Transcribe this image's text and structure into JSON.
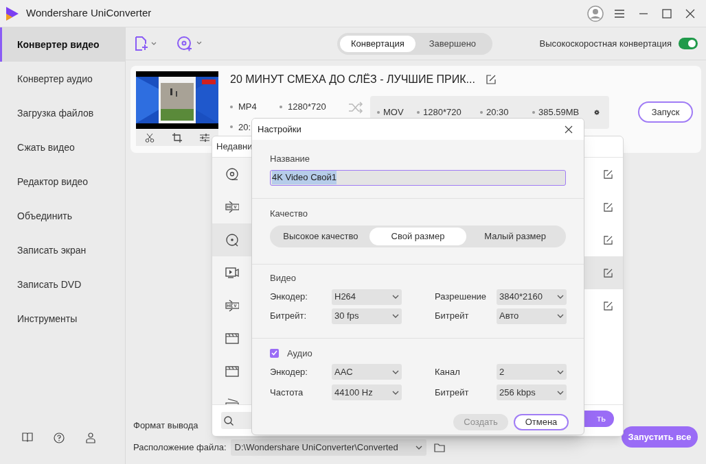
{
  "window": {
    "title": "Wondershare UniConverter"
  },
  "sidebar": {
    "items": [
      {
        "label": "Конвертер видео",
        "selected": true
      },
      {
        "label": "Конвертер аудио",
        "selected": false
      },
      {
        "label": "Загрузка файлов",
        "selected": false
      },
      {
        "label": "Сжать видео",
        "selected": false
      },
      {
        "label": "Редактор видео",
        "selected": false
      },
      {
        "label": "Объединить",
        "selected": false
      },
      {
        "label": "Записать экран",
        "selected": false
      },
      {
        "label": "Записать DVD",
        "selected": false
      },
      {
        "label": "Инструменты",
        "selected": false
      }
    ]
  },
  "toolbar": {
    "tabs": [
      {
        "label": "Конвертация",
        "selected": true
      },
      {
        "label": "Завершено",
        "selected": false
      }
    ],
    "fast_conversion": {
      "label": "Высокоскоростная конвертация",
      "on": true
    }
  },
  "file": {
    "title": "20 МИНУТ СМЕХА ДО СЛЁЗ - ЛУЧШИЕ ПРИК...",
    "source": [
      "MP4",
      "1280*720",
      "20:"
    ],
    "target": [
      "MOV",
      "1280*720",
      "20:30",
      "385.59MB"
    ],
    "start_button": "Запуск"
  },
  "bottom": {
    "output_format_label": "Формат вывода",
    "location_label": "Расположение файла:",
    "location_path": "D:\\Wondershare UniConverter\\Converted",
    "start_all": "Запустить все"
  },
  "format_popup": {
    "header": "Недавни",
    "button": "ть",
    "rows": [
      {
        "kind": "disc",
        "selected": false,
        "hovered": false,
        "editable": true
      },
      {
        "kind": "hevc",
        "selected": false,
        "hovered": false,
        "editable": true
      },
      {
        "kind": "disc-dot",
        "selected": true,
        "hovered": false,
        "editable": true
      },
      {
        "kind": "video",
        "selected": false,
        "hovered": true,
        "editable": true
      },
      {
        "kind": "hevc",
        "selected": false,
        "hovered": false,
        "editable": true
      },
      {
        "kind": "clapper",
        "selected": false,
        "hovered": false,
        "editable": false
      },
      {
        "kind": "clapper",
        "selected": false,
        "hovered": false,
        "editable": false
      },
      {
        "kind": "m4v",
        "selected": false,
        "hovered": false,
        "editable": false
      }
    ]
  },
  "dialog": {
    "title": "Настройки",
    "name": {
      "label": "Название",
      "value": "4K Video Свой1"
    },
    "quality": {
      "label": "Качество",
      "options": [
        {
          "label": "Высокое качество",
          "selected": false
        },
        {
          "label": "Свой размер",
          "selected": true
        },
        {
          "label": "Малый размер",
          "selected": false
        }
      ]
    },
    "video": {
      "label": "Видео",
      "fields": [
        {
          "label": "Энкодер:",
          "value": "H264"
        },
        {
          "label": "Разрешение",
          "value": "3840*2160"
        },
        {
          "label": "Битрейт:",
          "value": "30 fps"
        },
        {
          "label": "Битрейт",
          "value": "Авто"
        }
      ]
    },
    "audio": {
      "label": "Аудио",
      "checked": true,
      "fields": [
        {
          "label": "Энкодер:",
          "value": "AAC"
        },
        {
          "label": "Канал",
          "value": "2"
        },
        {
          "label": "Частота",
          "value": "44100 Hz"
        },
        {
          "label": "Битрейт",
          "value": "256 kbps"
        }
      ]
    },
    "buttons": [
      {
        "label": "Создать",
        "disabled": true
      },
      {
        "label": "Отмена",
        "disabled": false
      }
    ]
  }
}
